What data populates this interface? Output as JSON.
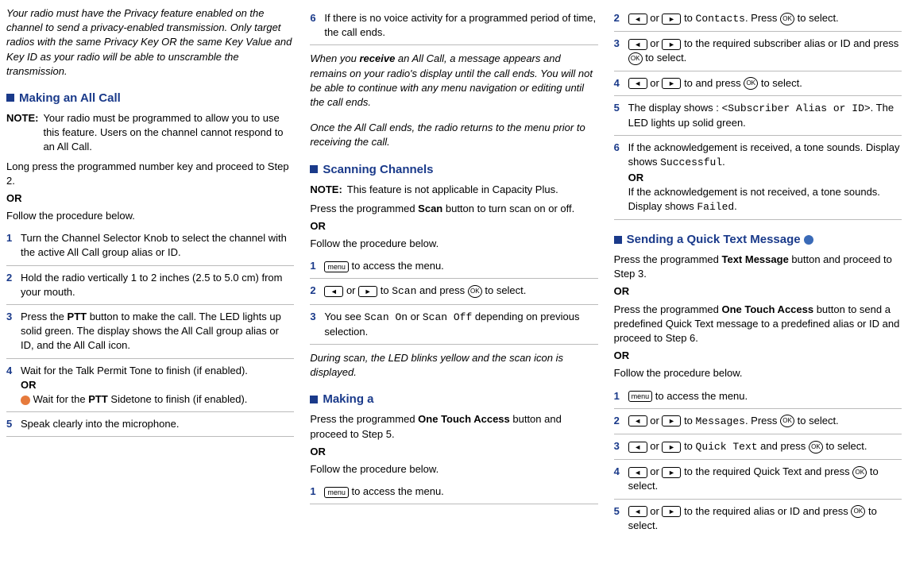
{
  "col1": {
    "intro": "Your radio must have the Privacy feature enabled on the channel to send a privacy-enabled transmission. Only target radios with the same Privacy Key OR the same Key Value and Key ID as your radio will be able to unscramble the transmission.",
    "h1": "Making an All Call",
    "note_label": "NOTE:",
    "note_body": "Your radio must be programmed to allow you to use this feature. Users on the channel cannot respond to an All Call.",
    "p1": "Long press the programmed number key and proceed to Step 2.",
    "or": "OR",
    "p2": "Follow the procedure below.",
    "s1": "Turn the Channel Selector Knob to select the channel with the active All Call group alias or ID.",
    "s2": "Hold the radio vertically 1 to 2 inches (2.5 to 5.0 cm) from your mouth.",
    "s3a": "Press the ",
    "s3b": "PTT",
    "s3c": " button to make the call. The LED lights up solid green. The display shows the All Call group alias or ID, and the All Call icon.",
    "s4a": "Wait for the Talk Permit Tone to finish (if enabled).",
    "s4b": " Wait for the ",
    "s4c": "PTT",
    "s4d": " Sidetone to finish (if enabled).",
    "s5": "Speak clearly into the microphone."
  },
  "col2": {
    "s6": "If there is no voice activity for a programmed period of time, the call ends.",
    "i1a": "When you ",
    "i1b": "receive",
    "i1c": " an All Call, a message appears and remains on your radio's display until the call ends. You will not be able to continue with any menu navigation or editing until the call ends.",
    "i2": "Once the All Call ends, the radio returns to the menu prior to receiving the call.",
    "h1": "Scanning Channels",
    "note_label": "NOTE:",
    "note_body": "This feature is not applicable in Capacity Plus.",
    "p1a": "Press the programmed ",
    "p1b": "Scan",
    "p1c": " button to turn scan on or off.",
    "or": "OR",
    "p2": "Follow the procedure below.",
    "sc1": " to access the menu.",
    "sc2a": " to ",
    "sc2b": "Scan",
    "sc2c": " and press ",
    "sc2d": " to select.",
    "sc3a": "You see ",
    "sc3b": "Scan On",
    "sc3c": " or ",
    "sc3d": "Scan Off",
    "sc3e": " depending on previous selection.",
    "i3": "During scan, the LED blinks yellow and the scan icon is displayed.",
    "h2": "Making a",
    "p3a": "Press the programmed ",
    "p3b": "One Touch Access",
    "p3c": " button and proceed to Step 5.",
    "p4": "Follow the procedure below.",
    "mk1": " to access the menu."
  },
  "col3": {
    "s2a": " to ",
    "s2b": "Contacts",
    "s2c": ". Press ",
    "s2d": " to select.",
    "s3a": " to the required subscriber alias or ID and press ",
    "s3b": " to select.",
    "s4a": " to  and press ",
    "s4b": " to select.",
    "s5a": "The display shows : ",
    "s5b": "<Subscriber Alias or ID>",
    "s5c": ". The LED lights up solid green.",
    "s6a": "If the  acknowledgement is received, a tone sounds. Display shows  ",
    "s6b": "Successful",
    "s6c": ".",
    "s6d": "If the  acknowledgement is not received, a tone sounds. Display shows  ",
    "s6e": "Failed",
    "s6f": ".",
    "or": "OR",
    "h1": "Sending a Quick Text Message ",
    "p1a": "Press the programmed ",
    "p1b": "Text Message",
    "p1c": " button and proceed to Step 3.",
    "p2a": "Press the programmed ",
    "p2b": "One Touch Access",
    "p2c": " button to send a predefined Quick Text message to a predefined alias or ID and proceed to Step 6.",
    "p3": "Follow the procedure below.",
    "q1": " to access the menu.",
    "q2a": " to ",
    "q2b": "Messages",
    "q2c": ". Press ",
    "q2d": " to select.",
    "q3a": " to ",
    "q3b": "Quick Text",
    "q3c": " and press ",
    "q3d": " to select.",
    "q4a": " to the required Quick Text and press ",
    "q4b": " to select.",
    "q5a": " to the required alias or ID and press ",
    "q5b": " to select."
  },
  "icons": {
    "menu": "menu",
    "left": "◄",
    "right": "►",
    "ok": "OK",
    "or_word": " or "
  },
  "nums": {
    "n1": "1",
    "n2": "2",
    "n3": "3",
    "n4": "4",
    "n5": "5",
    "n6": "6"
  }
}
